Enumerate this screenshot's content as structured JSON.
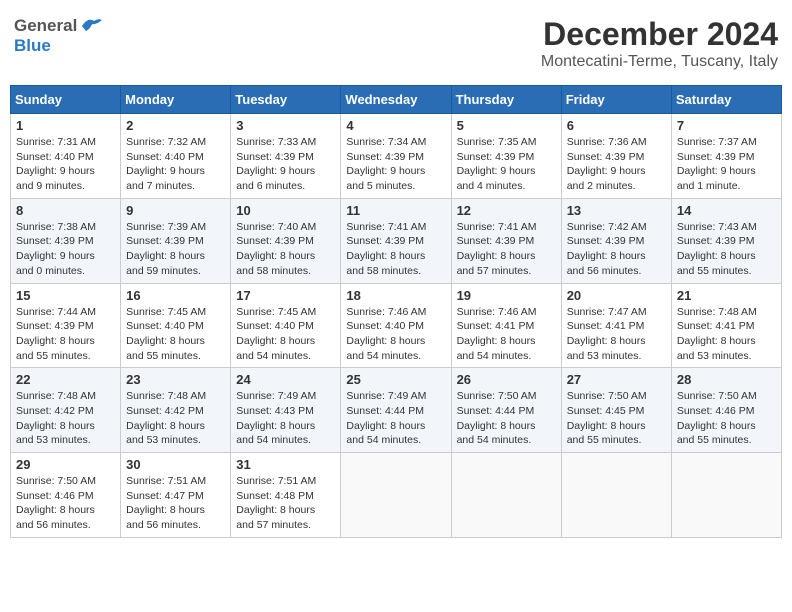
{
  "header": {
    "logo_general": "General",
    "logo_blue": "Blue",
    "month": "December 2024",
    "location": "Montecatini-Terme, Tuscany, Italy"
  },
  "days_of_week": [
    "Sunday",
    "Monday",
    "Tuesday",
    "Wednesday",
    "Thursday",
    "Friday",
    "Saturday"
  ],
  "weeks": [
    [
      {
        "day": 1,
        "sunrise": "7:31 AM",
        "sunset": "4:40 PM",
        "daylight": "9 hours and 9 minutes."
      },
      {
        "day": 2,
        "sunrise": "7:32 AM",
        "sunset": "4:40 PM",
        "daylight": "9 hours and 7 minutes."
      },
      {
        "day": 3,
        "sunrise": "7:33 AM",
        "sunset": "4:39 PM",
        "daylight": "9 hours and 6 minutes."
      },
      {
        "day": 4,
        "sunrise": "7:34 AM",
        "sunset": "4:39 PM",
        "daylight": "9 hours and 5 minutes."
      },
      {
        "day": 5,
        "sunrise": "7:35 AM",
        "sunset": "4:39 PM",
        "daylight": "9 hours and 4 minutes."
      },
      {
        "day": 6,
        "sunrise": "7:36 AM",
        "sunset": "4:39 PM",
        "daylight": "9 hours and 2 minutes."
      },
      {
        "day": 7,
        "sunrise": "7:37 AM",
        "sunset": "4:39 PM",
        "daylight": "9 hours and 1 minute."
      }
    ],
    [
      {
        "day": 8,
        "sunrise": "7:38 AM",
        "sunset": "4:39 PM",
        "daylight": "9 hours and 0 minutes."
      },
      {
        "day": 9,
        "sunrise": "7:39 AM",
        "sunset": "4:39 PM",
        "daylight": "8 hours and 59 minutes."
      },
      {
        "day": 10,
        "sunrise": "7:40 AM",
        "sunset": "4:39 PM",
        "daylight": "8 hours and 58 minutes."
      },
      {
        "day": 11,
        "sunrise": "7:41 AM",
        "sunset": "4:39 PM",
        "daylight": "8 hours and 58 minutes."
      },
      {
        "day": 12,
        "sunrise": "7:41 AM",
        "sunset": "4:39 PM",
        "daylight": "8 hours and 57 minutes."
      },
      {
        "day": 13,
        "sunrise": "7:42 AM",
        "sunset": "4:39 PM",
        "daylight": "8 hours and 56 minutes."
      },
      {
        "day": 14,
        "sunrise": "7:43 AM",
        "sunset": "4:39 PM",
        "daylight": "8 hours and 55 minutes."
      }
    ],
    [
      {
        "day": 15,
        "sunrise": "7:44 AM",
        "sunset": "4:39 PM",
        "daylight": "8 hours and 55 minutes."
      },
      {
        "day": 16,
        "sunrise": "7:45 AM",
        "sunset": "4:40 PM",
        "daylight": "8 hours and 55 minutes."
      },
      {
        "day": 17,
        "sunrise": "7:45 AM",
        "sunset": "4:40 PM",
        "daylight": "8 hours and 54 minutes."
      },
      {
        "day": 18,
        "sunrise": "7:46 AM",
        "sunset": "4:40 PM",
        "daylight": "8 hours and 54 minutes."
      },
      {
        "day": 19,
        "sunrise": "7:46 AM",
        "sunset": "4:41 PM",
        "daylight": "8 hours and 54 minutes."
      },
      {
        "day": 20,
        "sunrise": "7:47 AM",
        "sunset": "4:41 PM",
        "daylight": "8 hours and 53 minutes."
      },
      {
        "day": 21,
        "sunrise": "7:48 AM",
        "sunset": "4:41 PM",
        "daylight": "8 hours and 53 minutes."
      }
    ],
    [
      {
        "day": 22,
        "sunrise": "7:48 AM",
        "sunset": "4:42 PM",
        "daylight": "8 hours and 53 minutes."
      },
      {
        "day": 23,
        "sunrise": "7:48 AM",
        "sunset": "4:42 PM",
        "daylight": "8 hours and 53 minutes."
      },
      {
        "day": 24,
        "sunrise": "7:49 AM",
        "sunset": "4:43 PM",
        "daylight": "8 hours and 54 minutes."
      },
      {
        "day": 25,
        "sunrise": "7:49 AM",
        "sunset": "4:44 PM",
        "daylight": "8 hours and 54 minutes."
      },
      {
        "day": 26,
        "sunrise": "7:50 AM",
        "sunset": "4:44 PM",
        "daylight": "8 hours and 54 minutes."
      },
      {
        "day": 27,
        "sunrise": "7:50 AM",
        "sunset": "4:45 PM",
        "daylight": "8 hours and 55 minutes."
      },
      {
        "day": 28,
        "sunrise": "7:50 AM",
        "sunset": "4:46 PM",
        "daylight": "8 hours and 55 minutes."
      }
    ],
    [
      {
        "day": 29,
        "sunrise": "7:50 AM",
        "sunset": "4:46 PM",
        "daylight": "8 hours and 56 minutes."
      },
      {
        "day": 30,
        "sunrise": "7:51 AM",
        "sunset": "4:47 PM",
        "daylight": "8 hours and 56 minutes."
      },
      {
        "day": 31,
        "sunrise": "7:51 AM",
        "sunset": "4:48 PM",
        "daylight": "8 hours and 57 minutes."
      },
      null,
      null,
      null,
      null
    ]
  ]
}
